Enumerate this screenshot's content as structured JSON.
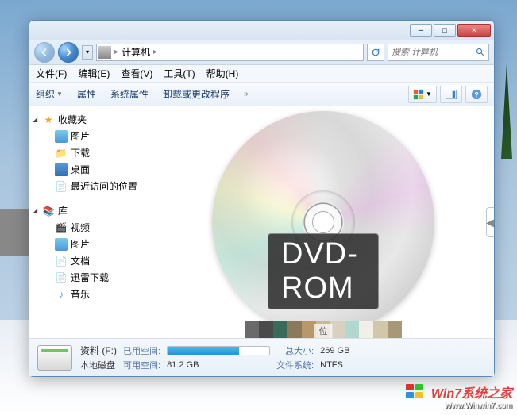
{
  "address": {
    "location": "计算机",
    "arrow": "▸"
  },
  "search": {
    "placeholder": "搜索 计算机"
  },
  "menu": {
    "file": "文件(F)",
    "edit": "编辑(E)",
    "view": "查看(V)",
    "tools": "工具(T)",
    "help": "帮助(H)"
  },
  "toolbar": {
    "organize": "组织",
    "properties": "属性",
    "sysprops": "系统属性",
    "uninstall": "卸载或更改程序"
  },
  "sidebar": {
    "favorites": {
      "label": "收藏夹",
      "items": [
        "图片",
        "下载",
        "桌面",
        "最近访问的位置"
      ]
    },
    "libraries": {
      "label": "库",
      "items": [
        "视频",
        "图片",
        "文档",
        "迅雷下载",
        "音乐"
      ]
    }
  },
  "main": {
    "disc_label": "DVD-ROM",
    "swatch_caption": "位"
  },
  "details": {
    "drive_name": "资料 (F:)",
    "used_label": "已用空间:",
    "disk_type": "本地磁盘",
    "free_label": "可用空间:",
    "free_value": "81.2 GB",
    "total_label": "总大小:",
    "total_value": "269 GB",
    "fs_label": "文件系统:",
    "fs_value": "NTFS"
  },
  "swatches": [
    "#6a6a6a",
    "#4a4a4a",
    "#3a6a5a",
    "#8a7a5a",
    "#b8986a",
    "#c8b8a0",
    "#d8d0c0",
    "#b0d8d0",
    "#f0f0e8",
    "#d0c8a8",
    "#a89878"
  ],
  "watermark": {
    "title": "Win7系统之家",
    "url": "Www.Winwin7.com"
  }
}
